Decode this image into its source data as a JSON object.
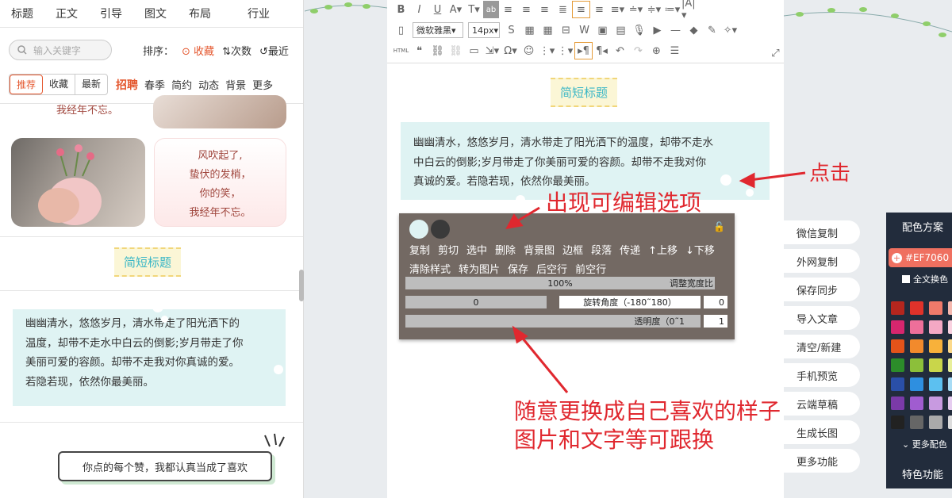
{
  "left_panel": {
    "nav": [
      "标题",
      "正文",
      "引导",
      "图文",
      "布局",
      "行业"
    ],
    "search_placeholder": "输入关键字",
    "sort_label": "排序：",
    "sort_options": [
      "收藏",
      "次数",
      "最近"
    ],
    "segments": [
      "推荐",
      "收藏",
      "最新"
    ],
    "categories": [
      "招聘",
      "春季",
      "简约",
      "动态",
      "背景",
      "更多"
    ],
    "poem_top_fragment": "我经年不忘。",
    "poem_lines": [
      "风吹起了,",
      "蛰伏的发梢，",
      "你的笑，",
      "我经年不忘。"
    ],
    "short_title": "简短标题",
    "paragraph": [
      "幽幽清水，悠悠岁月，清水带走了阳光洒下的",
      "温度，却带不走水中白云的倒影;岁月带走了你",
      "美丽可爱的容颜。却带不走我对你真诚的爱。",
      "若隐若现，依然你最美丽。"
    ],
    "bubble_text": "你点的每个赞，我都认真当成了喜欢"
  },
  "editor": {
    "font_family": "微软雅黑",
    "font_size": "14px",
    "html_label": "HTML",
    "short_title": "简短标题",
    "paragraph": [
      "幽幽清水，悠悠岁月，清水带走了阳光洒下的温度，却带不走水",
      "中白云的倒影;岁月带走了你美丽可爱的容颜。却带不走我对你",
      "真诚的爱。若隐若现，依然你最美丽。"
    ]
  },
  "popup": {
    "actions_row1": [
      "复制",
      "剪切",
      "选中",
      "删除",
      "背景图",
      "边框",
      "段落",
      "传递",
      "↑上移",
      "↓下移"
    ],
    "actions_row2": [
      "清除样式",
      "转为图片",
      "保存",
      "后空行",
      "前空行"
    ],
    "width_value": "100%",
    "width_label": "调整宽度比",
    "rotate_value": "0",
    "rotate_label": "旋转角度（-180˜180）",
    "rotate_input": "0",
    "opacity_label": "透明度（0˜1",
    "opacity_input": "1"
  },
  "annotations": {
    "click": "点击",
    "appears": "出现可编辑选项",
    "note_line1": "随意更换成自己喜欢的样子",
    "note_line2": "图片和文字等可跟换"
  },
  "right_buttons": [
    "微信复制",
    "外网复制",
    "保存同步",
    "导入文章",
    "清空/新建",
    "手机预览",
    "云端草稿",
    "生成长图",
    "更多功能"
  ],
  "palette": {
    "title": "配色方案",
    "current_color": "#EF7060",
    "full_swap": "全文换色",
    "more_colors": "更多配色",
    "special": "特色功能",
    "swatches": [
      "#b5261e",
      "#e0322a",
      "#f07a6a",
      "#f5b8ae",
      "#d6266e",
      "#ee6f9a",
      "#f4a8c4",
      "#f9d2e0",
      "#e3531a",
      "#f28a2c",
      "#f8b13a",
      "#fcd98a",
      "#2c8c2a",
      "#8cbf3a",
      "#c9d64a",
      "#e8ef9a",
      "#2a4fa8",
      "#2e8fe0",
      "#5cc0f0",
      "#a8dcf5",
      "#7a3aa8",
      "#a05cd0",
      "#c89ae0",
      "#e6cdf0",
      "#222222",
      "#666666",
      "#aaaaaa",
      "#dddddd"
    ]
  }
}
